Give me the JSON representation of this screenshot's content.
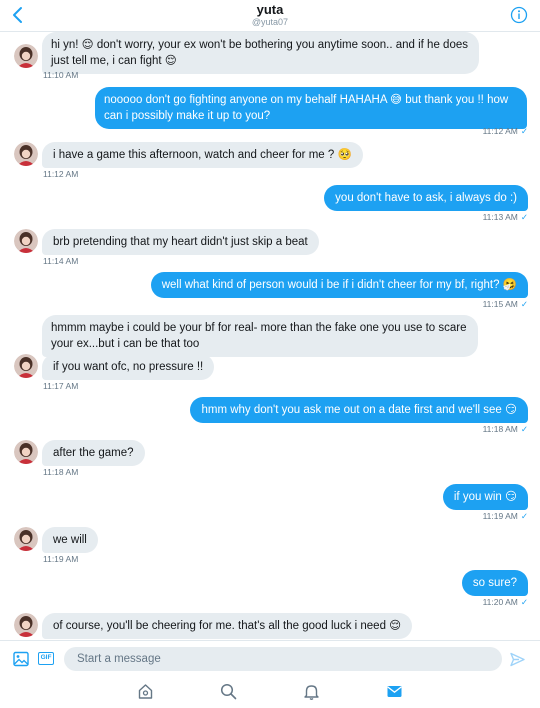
{
  "header": {
    "title": "yuta",
    "handle": "@yuta07",
    "back_icon": "chevron-left-icon",
    "info_icon": "info-icon"
  },
  "messages": [
    {
      "dir": "in",
      "text": "hi yn! 😌 don't worry, your ex won't be bothering you anytime soon.. and if he does just tell me, i can fight 😌",
      "time": "11:10 AM"
    },
    {
      "dir": "out",
      "text": "nooooo don't go fighting anyone on my behalf HAHAHA 😅 but thank you !! how can i possibly make it up to you?",
      "time": "11:12 AM"
    },
    {
      "dir": "in",
      "text": "i have a game this afternoon, watch and cheer for me ? 🥺",
      "time": "11:12 AM"
    },
    {
      "dir": "out",
      "text": "you don't have to ask, i always do :)",
      "time": "11:13 AM"
    },
    {
      "dir": "in",
      "text": "brb pretending that my heart didn't just skip a beat",
      "time": "11:14 AM"
    },
    {
      "dir": "out",
      "text": "well what kind of person would i be if i didn't cheer for my bf, right? 🤧",
      "time": "11:15 AM"
    },
    {
      "dir": "in",
      "text": "hmmm maybe i could be your bf for real- more than the fake one you use to scare your ex...but i can be that too",
      "time": ""
    },
    {
      "dir": "in",
      "text": "if you want ofc, no pressure !!",
      "time": "11:17 AM"
    },
    {
      "dir": "out",
      "text": "hmm why don't you ask me out on a date first and we'll see 😏",
      "time": "11:18 AM"
    },
    {
      "dir": "in",
      "text": "after the game?",
      "time": "11:18 AM"
    },
    {
      "dir": "out",
      "text": "if you win 😏",
      "time": "11:19 AM"
    },
    {
      "dir": "in",
      "text": "we will",
      "time": "11:19 AM"
    },
    {
      "dir": "out",
      "text": "so sure?",
      "time": "11:20 AM"
    },
    {
      "dir": "in",
      "text": "of course, you'll be cheering for me. that's all the good luck i need 😌",
      "time": ""
    }
  ],
  "read_mark": "✓",
  "composer": {
    "placeholder": "Start a message",
    "gif_label": "GIF",
    "image_icon": "image-icon",
    "send_icon": "send-icon"
  },
  "tabbar": {
    "items": [
      "home-icon",
      "search-icon",
      "bell-icon",
      "mail-icon"
    ],
    "active": "mail-icon"
  },
  "colors": {
    "accent": "#1da1f2",
    "incoming_bubble": "#e6ecf0",
    "timestamp": "#657786"
  }
}
